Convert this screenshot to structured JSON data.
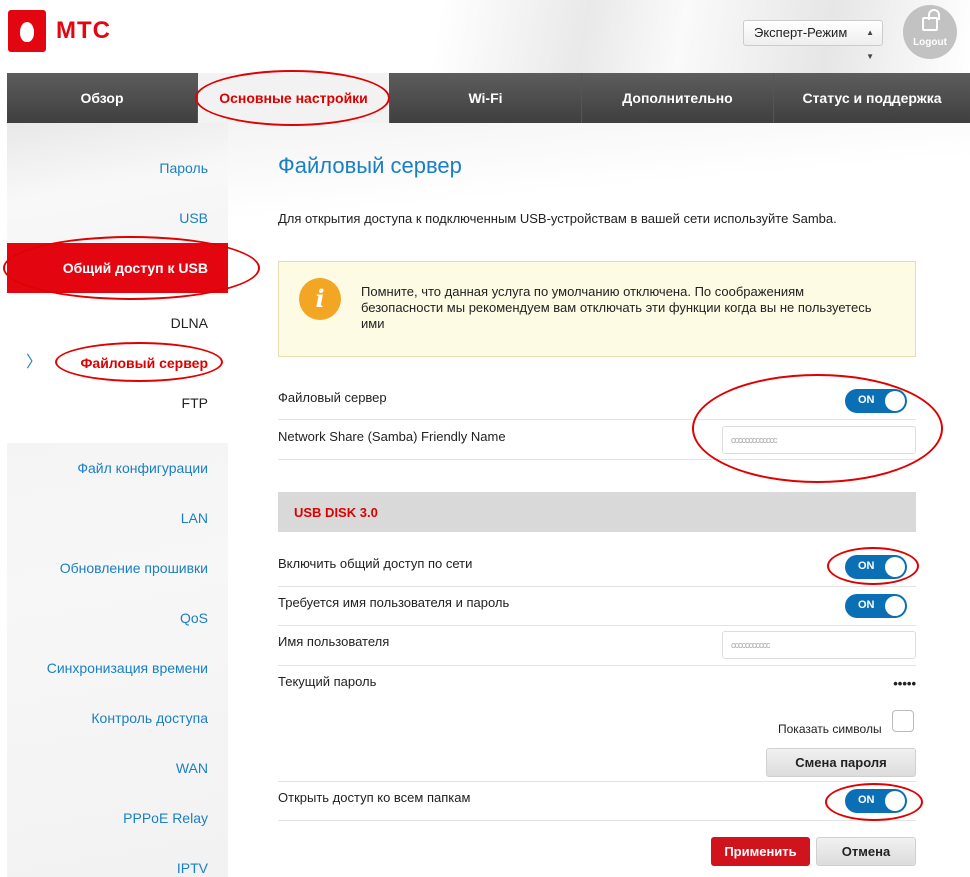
{
  "header": {
    "brand": "МТС",
    "mode_select": "Эксперт-Режим",
    "logout_label": "Logout"
  },
  "nav": {
    "tabs": [
      {
        "label": "Обзор"
      },
      {
        "label": "Основные настройки"
      },
      {
        "label": "Wi-Fi"
      },
      {
        "label": "Дополнительно"
      },
      {
        "label": "Статус и поддержка"
      }
    ]
  },
  "sidebar": {
    "items": [
      {
        "label": "Пароль"
      },
      {
        "label": "USB"
      },
      {
        "label": "Общий доступ к USB"
      },
      {
        "label": "DLNA"
      },
      {
        "label": "Файловый сервер"
      },
      {
        "label": "FTP"
      },
      {
        "label": "Файл конфигурации"
      },
      {
        "label": "LAN"
      },
      {
        "label": "Обновление прошивки"
      },
      {
        "label": "QoS"
      },
      {
        "label": "Синхронизация времени"
      },
      {
        "label": "Контроль доступа"
      },
      {
        "label": "WAN"
      },
      {
        "label": "PPPoE Relay"
      },
      {
        "label": "IPTV"
      }
    ],
    "chevron": "〉"
  },
  "main": {
    "title": "Файловый сервер",
    "intro": "Для открытия доступа к подключенным USB-устройствам в вашей сети используйте Samba.",
    "notice": {
      "icon": "info-icon",
      "text": "Помните, что данная услуга по умолчанию отключена. По соображениям безопасности мы рекомендуем вам отключать эти функции когда вы не пользуетесь ими"
    },
    "file_server": {
      "label": "Файловый сервер",
      "toggle": "ON"
    },
    "friendly_name": {
      "label": "Network Share (Samba) Friendly Name",
      "value": "ccccccccccccc"
    },
    "section_title": "USB DISK 3.0",
    "share_network": {
      "label": "Включить общий доступ по сети",
      "toggle": "ON"
    },
    "require_credentials": {
      "label": "Требуется имя пользователя и пароль",
      "toggle": "ON"
    },
    "username": {
      "label": "Имя пользователя",
      "value": "ccccccccccc"
    },
    "current_password": {
      "label": "Текущий пароль",
      "value": "•••••"
    },
    "show_chars_label": "Показать символы",
    "change_password_button": "Смена пароля",
    "open_all_folders": {
      "label": "Открыть доступ ко всем папкам",
      "toggle": "ON"
    },
    "apply_button": "Применить",
    "cancel_button": "Отмена"
  },
  "colors": {
    "brand_red": "#e30611",
    "link_blue": "#1a7fc4",
    "toggle_blue": "#0a6fb4",
    "annotation_red": "#e00000"
  }
}
